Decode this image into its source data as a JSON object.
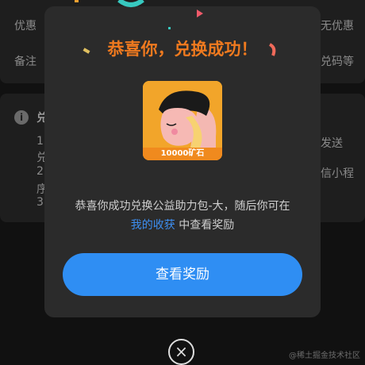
{
  "background": {
    "rows": [
      {
        "left": "优惠",
        "right": "无优惠"
      },
      {
        "left": "备注",
        "right": "兑码等"
      }
    ],
    "info_icon": "i",
    "info_title": "兑",
    "lines_left": [
      "1",
      "兑",
      "2",
      "序",
      "3"
    ],
    "lines_right": [
      "发送",
      "信小程"
    ]
  },
  "modal": {
    "title": "恭喜你，兑换成功！",
    "prize": {
      "caption": "10000矿石",
      "image": "character-illustration"
    },
    "description": {
      "before": "恭喜你成功兑换公益助力包-大，随后你可在",
      "link": "我的收获",
      "after": " 中查看奖励"
    },
    "button_label": "查看奖励"
  },
  "close_icon": "×",
  "watermark": "@稀土掘金技术社区",
  "colors": {
    "title": "#f07a1f",
    "link": "#3d8ef0",
    "button": "#2f8ef3",
    "modal_bg": "#2b2b2b"
  }
}
